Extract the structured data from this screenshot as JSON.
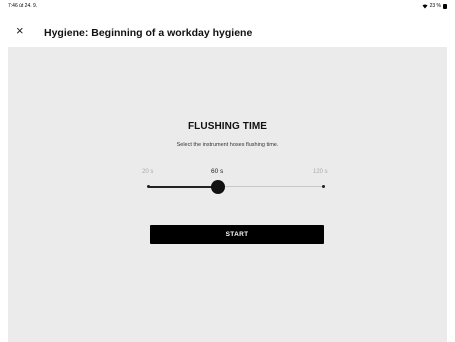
{
  "status": {
    "time": "7:46",
    "date": "út 24. 9.",
    "battery": "23 %",
    "icons": [
      "wifi-icon",
      "battery-icon"
    ]
  },
  "header": {
    "close_icon": "×",
    "title": "Hygiene: Beginning of a workday hygiene"
  },
  "panel": {
    "title": "FLUSHING TIME",
    "subtitle": "Select the instrument hoses flushing time.",
    "slider": {
      "min_label": "20 s",
      "value_label": "60 s",
      "max_label": "120 s",
      "min": 20,
      "max": 120,
      "value": 60
    },
    "start_label": "START"
  },
  "colors": {
    "background": "#ebebeb",
    "accent": "#000000",
    "track": "#c8c8c8"
  }
}
